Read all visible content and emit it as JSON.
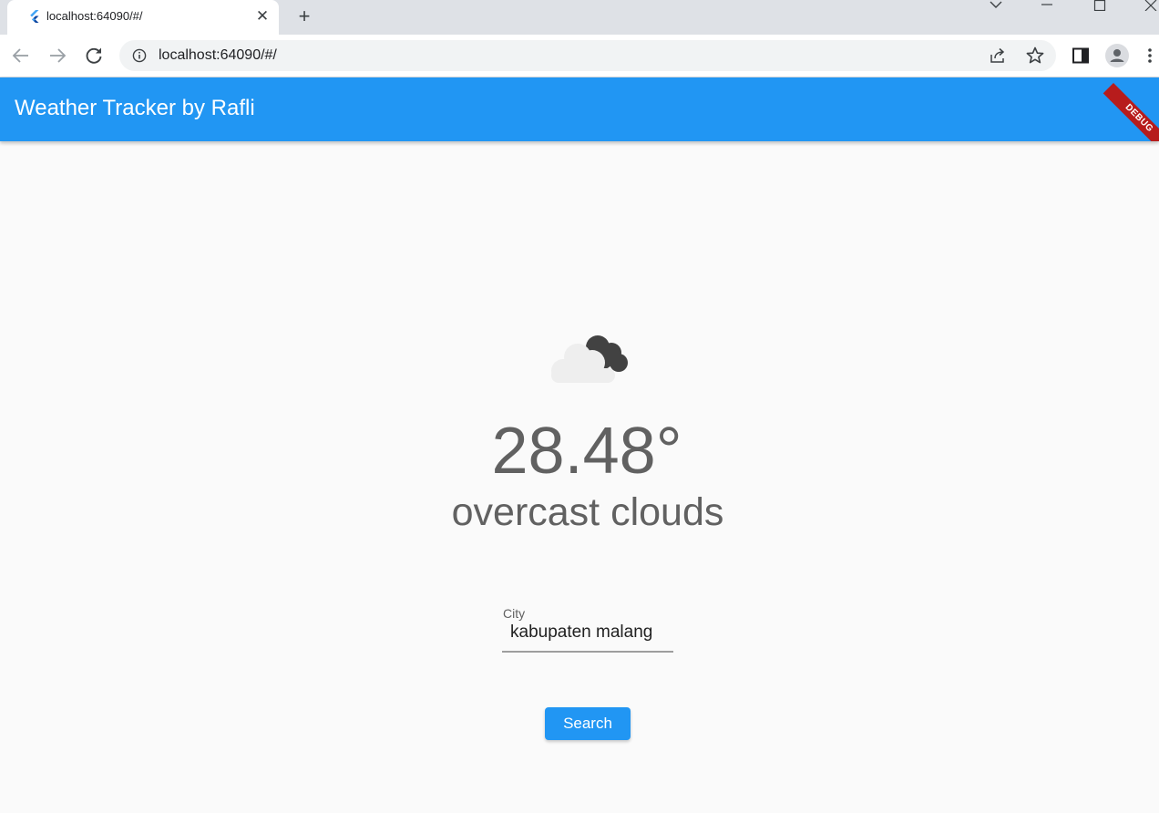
{
  "browser": {
    "tab_title": "localhost:64090/#/",
    "url": "localhost:64090/#/"
  },
  "app": {
    "title": "Weather Tracker by Rafli",
    "debug_label": "DEBUG",
    "primary_color": "#2196f3"
  },
  "weather": {
    "icon": "overcast-clouds-icon",
    "temperature": "28.48°",
    "description": "overcast clouds"
  },
  "form": {
    "city_label": "City",
    "city_value": "kabupaten malang",
    "search_label": "Search"
  }
}
